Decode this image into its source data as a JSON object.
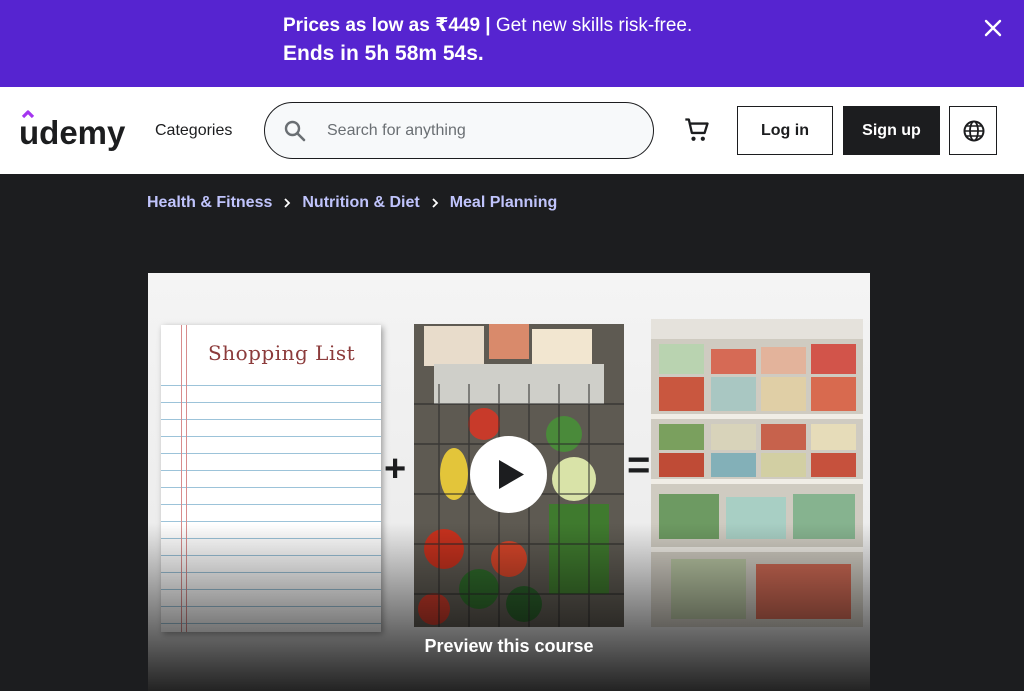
{
  "promo": {
    "headline_bold": "Prices as low as ₹449 |",
    "headline_rest": " Get new skills risk-free.",
    "countdown": "Ends in 5h 58m 54s.",
    "close_icon": "close-icon",
    "background_color": "#5624d0"
  },
  "header": {
    "logo_text": "udemy",
    "categories_label": "Categories",
    "search": {
      "placeholder": "Search for anything",
      "value": "",
      "icon": "search-icon"
    },
    "cart_icon": "cart-icon",
    "login_label": "Log in",
    "signup_label": "Sign up",
    "language_icon": "globe-icon"
  },
  "breadcrumb": {
    "items": [
      "Health & Fitness",
      "Nutrition & Diet",
      "Meal Planning"
    ],
    "separator_icon": "chevron-right-icon",
    "color": "#c0c4fc"
  },
  "course_preview": {
    "shopping_list_title": "Shopping List",
    "plus_symbol": "+",
    "equals_symbol": "=",
    "play_icon": "play-icon",
    "preview_label": "Preview this course"
  }
}
